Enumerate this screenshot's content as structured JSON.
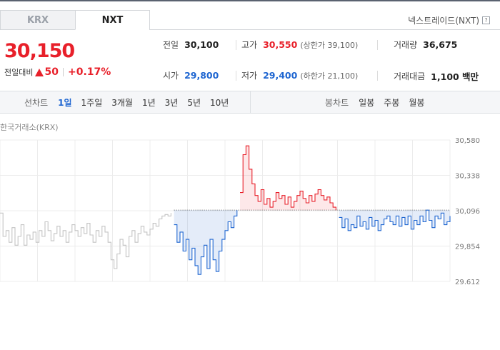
{
  "tabs": [
    {
      "label": "KRX",
      "active": false
    },
    {
      "label": "NXT",
      "active": true
    }
  ],
  "venue_label": "넥스트레이드(NXT)",
  "help_glyph": "?",
  "price": {
    "current": "30,150",
    "change_label": "전일대비",
    "change_value": "50",
    "change_pct": "+0.17%"
  },
  "quote": {
    "prev_close": {
      "label": "전일",
      "value": "30,100"
    },
    "high": {
      "label": "고가",
      "value": "30,550",
      "sub": "(상한가 39,100)"
    },
    "volume": {
      "label": "거래량",
      "value": "36,675"
    },
    "open": {
      "label": "시가",
      "value": "29,800"
    },
    "low": {
      "label": "저가",
      "value": "29,400",
      "sub": "(하한가 21,100)"
    },
    "amount": {
      "label": "거래대금",
      "value": "1,100 백만"
    }
  },
  "toolbar": {
    "line_label": "선차트",
    "line_items": [
      "1일",
      "1주일",
      "3개월",
      "1년",
      "3년",
      "5년",
      "10년"
    ],
    "candle_label": "봉차트",
    "candle_items": [
      "일봉",
      "주봉",
      "월봉"
    ]
  },
  "chart_title": "한국거래소(KRX)",
  "colors": {
    "up": "#e8202a",
    "down": "#1f66d1",
    "neutral": "#c4c4c4"
  },
  "chart_data": {
    "type": "line",
    "title": "한국거래소(KRX)",
    "ylim": [
      29612,
      30580
    ],
    "yticks": [
      "30,580",
      "30,338",
      "30,096",
      "29,854",
      "29,612"
    ],
    "baseline": 30100,
    "grid": true,
    "series": [
      {
        "color": "#c4c4c4",
        "values": [
          30080,
          29920,
          29960,
          29880,
          29980,
          29860,
          29920,
          30000,
          29860,
          29930,
          29900,
          29950,
          29880,
          29960,
          29920,
          30020,
          29960,
          29890,
          29940,
          29990,
          29920,
          29960,
          29880,
          29950,
          30000,
          29960,
          29920,
          29980,
          29940,
          30010,
          29930,
          29880,
          29960,
          29920,
          29990,
          29950,
          29880,
          29760,
          29700,
          29800,
          29900,
          29860,
          29780,
          29920,
          29960,
          29880,
          29940,
          29990,
          29950,
          29930,
          29970,
          30010,
          29990,
          30040,
          30060,
          30070,
          30060,
          30080
        ]
      },
      {
        "color": "#1f66d1",
        "values": [
          30000,
          29880,
          29950,
          29820,
          29900,
          29760,
          29840,
          29720,
          29660,
          29780,
          29860,
          29700,
          29900,
          29760,
          29680,
          29820,
          29900,
          29960,
          30020,
          29980,
          30060,
          30100
        ]
      },
      {
        "color": "#e8202a",
        "values": [
          30220,
          30480,
          30540,
          30380,
          30280,
          30200,
          30160,
          30240,
          30140,
          30180,
          30120,
          30160,
          30220,
          30180,
          30200,
          30140,
          30190,
          30120,
          30160,
          30200,
          30230,
          30180,
          30150,
          30200,
          30160,
          30210,
          30240,
          30200,
          30170,
          30190,
          30150,
          30120,
          30100
        ]
      },
      {
        "color": "#1f66d1",
        "values": [
          30050,
          29980,
          30040,
          29960,
          30000,
          29980,
          30060,
          29990,
          30020,
          29970,
          30050,
          29990,
          30030,
          29960,
          30000,
          30040,
          30060,
          30020,
          30000,
          30060,
          29990,
          30050,
          30000,
          30060,
          29970,
          30030,
          30000,
          30060,
          30020,
          30100,
          30030,
          29980,
          30060,
          30040,
          30080,
          30000,
          30020,
          30060
        ]
      }
    ]
  }
}
